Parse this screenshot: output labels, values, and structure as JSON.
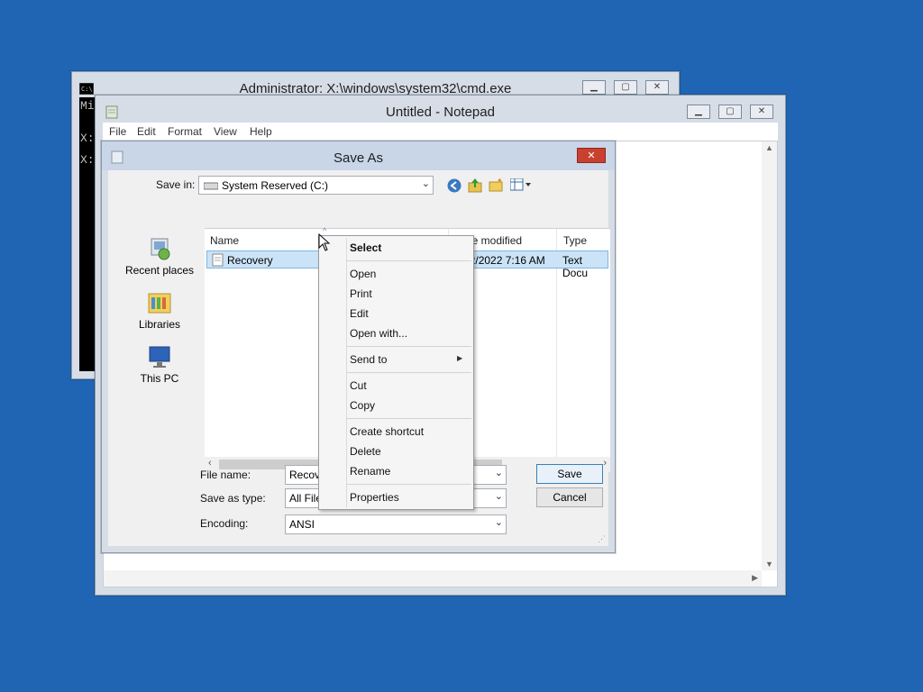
{
  "cmd": {
    "title": "Administrator: X:\\windows\\system32\\cmd.exe",
    "lines": [
      "Mi",
      "X:",
      "X:"
    ]
  },
  "notepad": {
    "title": "Untitled - Notepad",
    "menu": [
      "File",
      "Edit",
      "Format",
      "View",
      "Help"
    ]
  },
  "save_as": {
    "title": "Save As",
    "save_in_label": "Save in:",
    "save_in_value": "System Reserved (C:)",
    "places": [
      "Recent places",
      "Libraries",
      "This PC"
    ],
    "columns": [
      "Name",
      "Date modified",
      "Type"
    ],
    "rows": [
      {
        "name": "Recovery",
        "date": "3/12/2022 7:16 AM",
        "type": "Text Docu"
      }
    ],
    "file_name_label": "File name:",
    "file_name_value": "Recove",
    "save_as_type_label": "Save as type:",
    "save_as_type_value": "All Files",
    "encoding_label": "Encoding:",
    "encoding_value": "ANSI",
    "save_button": "Save",
    "cancel_button": "Cancel"
  },
  "context_menu": {
    "items": [
      "Select",
      "Open",
      "Print",
      "Edit",
      "Open with...",
      "Send to",
      "Cut",
      "Copy",
      "Create shortcut",
      "Delete",
      "Rename",
      "Properties"
    ]
  },
  "colors": {
    "desktop": "#1f65b3",
    "selection": "#cbe3f6",
    "close_button": "#c9402e"
  }
}
